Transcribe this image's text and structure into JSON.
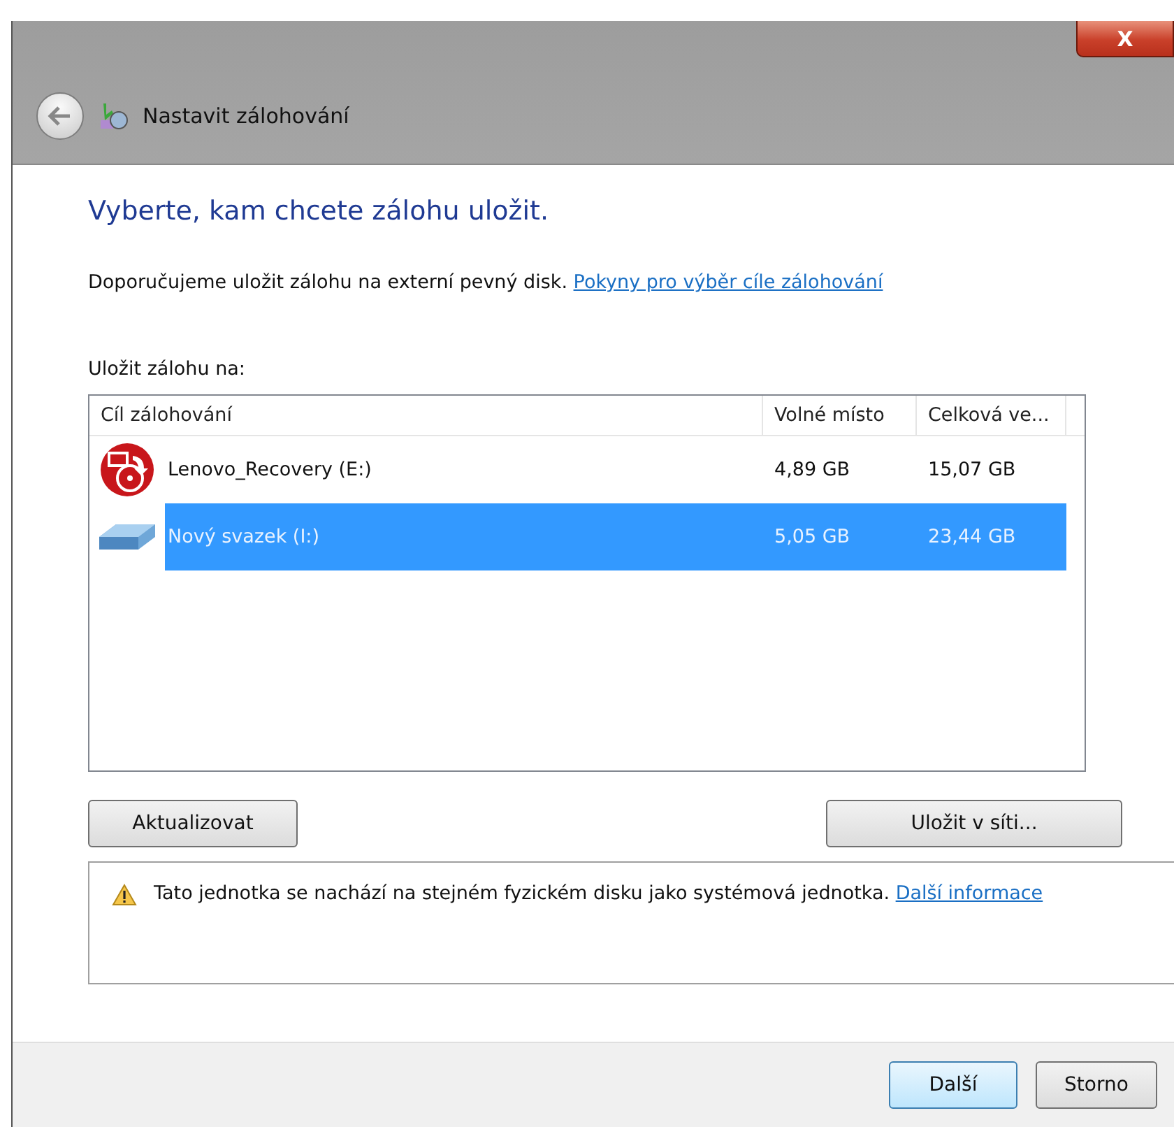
{
  "window": {
    "title": "Nastavit zálohování",
    "close": "X"
  },
  "heading": "Vyberte, kam chcete zálohu uložit.",
  "description": {
    "text": "Doporučujeme uložit zálohu na externí pevný disk.",
    "link": "Pokyny pro výběr cíle zálohování"
  },
  "list_label": "Uložit zálohu na:",
  "table": {
    "columns": [
      "Cíl zálohování",
      "Volné místo",
      "Celková ve..."
    ],
    "rows": [
      {
        "kind": "recovery",
        "name": "Lenovo_Recovery (E:)",
        "free": "4,89 GB",
        "total": "15,07 GB",
        "selected": false
      },
      {
        "kind": "drive",
        "name": "Nový svazek (I:)",
        "free": "5,05 GB",
        "total": "23,44 GB",
        "selected": true
      }
    ]
  },
  "buttons": {
    "refresh": "Aktualizovat",
    "network": "Uložit v síti..."
  },
  "warning": {
    "text": "Tato jednotka se nachází na stejném fyzickém disku jako systémová jednotka.",
    "link": "Další informace"
  },
  "footer": {
    "next": "Další",
    "cancel": "Storno"
  }
}
